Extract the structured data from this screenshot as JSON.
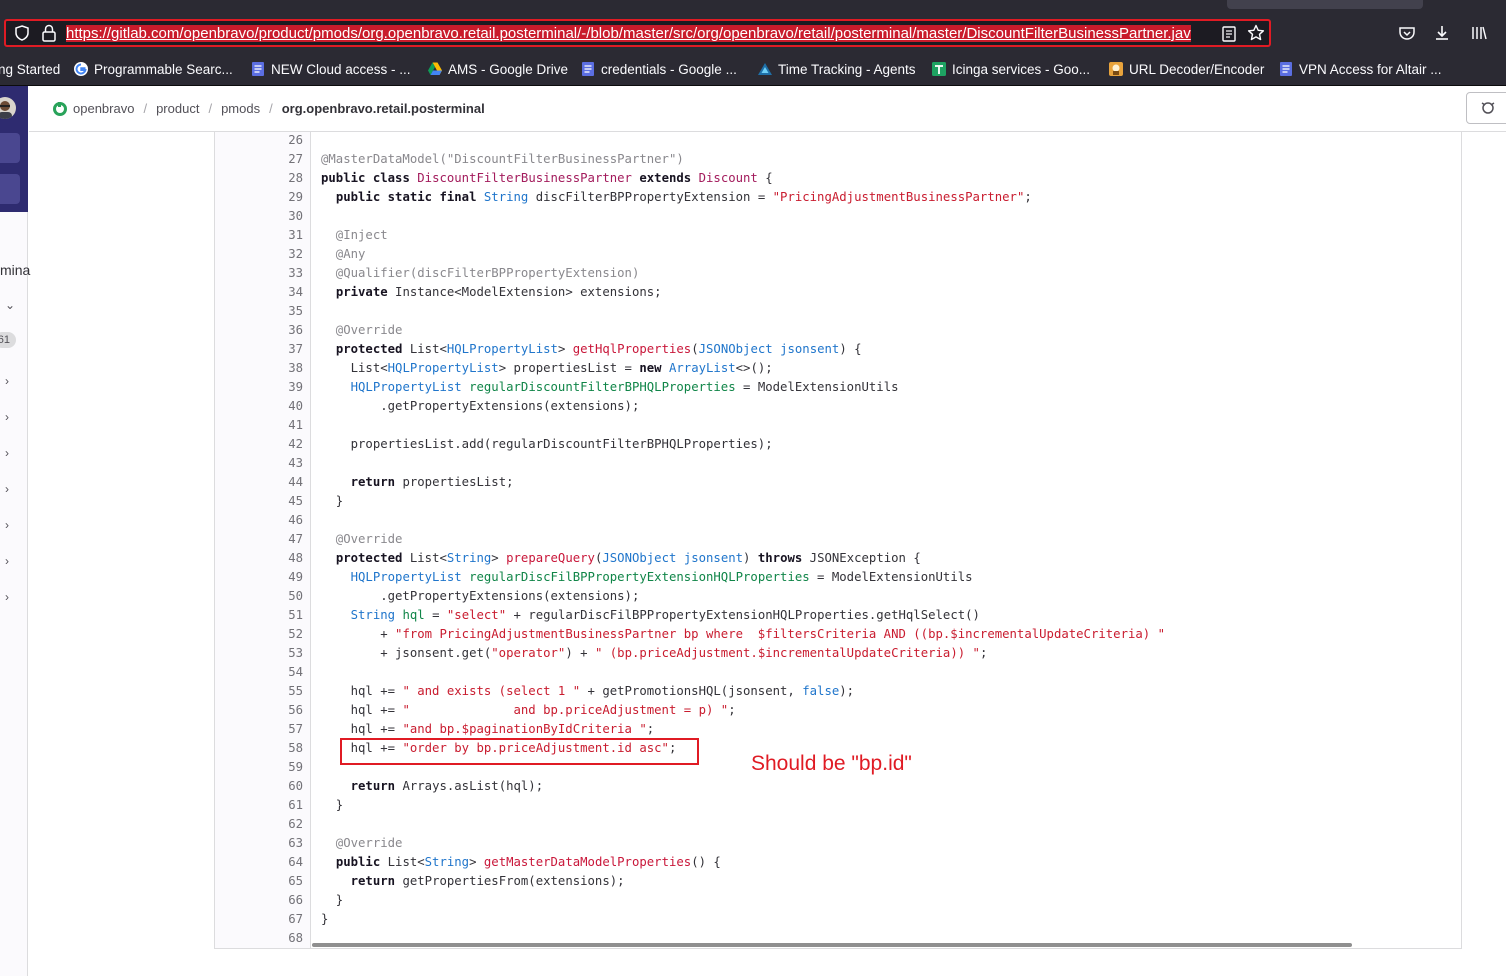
{
  "browser": {
    "url": "https://gitlab.com/openbravo/product/pmods/org.openbravo.retail.posterminal/-/blob/master/src/org/openbravo/retail/posterminal/master/DiscountFilterBusinessPartner.jav",
    "bookmarks": [
      {
        "label": "ng Started",
        "icon": "none"
      },
      {
        "label": "Programmable Searc...",
        "icon": "google-icon"
      },
      {
        "label": "NEW Cloud access - ...",
        "icon": "docs-icon"
      },
      {
        "label": "AMS - Google Drive",
        "icon": "drive-icon"
      },
      {
        "label": "credentials - Google ...",
        "icon": "docs-icon"
      },
      {
        "label": "Time Tracking - Agents",
        "icon": "tracking-icon"
      },
      {
        "label": "Icinga services - Goo...",
        "icon": "sheets-icon"
      },
      {
        "label": "URL Decoder/Encoder",
        "icon": "decoder-icon"
      },
      {
        "label": "VPN Access for Altair ...",
        "icon": "docs-icon"
      }
    ]
  },
  "sidebar": {
    "truncated_label": "mina",
    "count_badge": "61"
  },
  "breadcrumb": {
    "items": [
      "openbravo",
      "product",
      "pmods",
      "org.openbravo.retail.posterminal"
    ]
  },
  "code": {
    "lines": [
      {
        "n": "26",
        "t": ""
      },
      {
        "n": "27",
        "t": "@MasterDataModel(\"DiscountFilterBusinessPartner\")"
      },
      {
        "n": "28",
        "t": "public class DiscountFilterBusinessPartner extends Discount {"
      },
      {
        "n": "29",
        "t": "  public static final String discFilterBPPropertyExtension = \"PricingAdjustmentBusinessPartner\";"
      },
      {
        "n": "30",
        "t": ""
      },
      {
        "n": "31",
        "t": "  @Inject"
      },
      {
        "n": "32",
        "t": "  @Any"
      },
      {
        "n": "33",
        "t": "  @Qualifier(discFilterBPPropertyExtension)"
      },
      {
        "n": "34",
        "t": "  private Instance<ModelExtension> extensions;"
      },
      {
        "n": "35",
        "t": ""
      },
      {
        "n": "36",
        "t": "  @Override"
      },
      {
        "n": "37",
        "t": "  protected List<HQLPropertyList> getHqlProperties(JSONObject jsonsent) {"
      },
      {
        "n": "38",
        "t": "    List<HQLPropertyList> propertiesList = new ArrayList<>();"
      },
      {
        "n": "39",
        "t": "    HQLPropertyList regularDiscountFilterBPHQLProperties = ModelExtensionUtils"
      },
      {
        "n": "40",
        "t": "        .getPropertyExtensions(extensions);"
      },
      {
        "n": "41",
        "t": ""
      },
      {
        "n": "42",
        "t": "    propertiesList.add(regularDiscountFilterBPHQLProperties);"
      },
      {
        "n": "43",
        "t": ""
      },
      {
        "n": "44",
        "t": "    return propertiesList;"
      },
      {
        "n": "45",
        "t": "  }"
      },
      {
        "n": "46",
        "t": ""
      },
      {
        "n": "47",
        "t": "  @Override"
      },
      {
        "n": "48",
        "t": "  protected List<String> prepareQuery(JSONObject jsonsent) throws JSONException {"
      },
      {
        "n": "49",
        "t": "    HQLPropertyList regularDiscFilBPPropertyExtensionHQLProperties = ModelExtensionUtils"
      },
      {
        "n": "50",
        "t": "        .getPropertyExtensions(extensions);"
      },
      {
        "n": "51",
        "t": "    String hql = \"select\" + regularDiscFilBPPropertyExtensionHQLProperties.getHqlSelect()"
      },
      {
        "n": "52",
        "t": "        + \"from PricingAdjustmentBusinessPartner bp where  $filtersCriteria AND ((bp.$incrementalUpdateCriteria) \""
      },
      {
        "n": "53",
        "t": "        + jsonsent.get(\"operator\") + \" (bp.priceAdjustment.$incrementalUpdateCriteria)) \";"
      },
      {
        "n": "54",
        "t": ""
      },
      {
        "n": "55",
        "t": "    hql += \" and exists (select 1 \" + getPromotionsHQL(jsonsent, false);"
      },
      {
        "n": "56",
        "t": "    hql += \"              and bp.priceAdjustment = p) \";"
      },
      {
        "n": "57",
        "t": "    hql += \"and bp.$paginationByIdCriteria \";"
      },
      {
        "n": "58",
        "t": "    hql += \"order by bp.priceAdjustment.id asc\";"
      },
      {
        "n": "59",
        "t": ""
      },
      {
        "n": "60",
        "t": "    return Arrays.asList(hql);"
      },
      {
        "n": "61",
        "t": "  }"
      },
      {
        "n": "62",
        "t": ""
      },
      {
        "n": "63",
        "t": "  @Override"
      },
      {
        "n": "64",
        "t": "  public List<String> getMasterDataModelProperties() {"
      },
      {
        "n": "65",
        "t": "    return getPropertiesFrom(extensions);"
      },
      {
        "n": "66",
        "t": "  }"
      },
      {
        "n": "67",
        "t": "}"
      },
      {
        "n": "68",
        "t": ""
      }
    ]
  },
  "annotation": {
    "text": "Should be \"bp.id\""
  },
  "colors": {
    "annotation_red": "#e01b24",
    "browser_chrome": "#2b2a33",
    "gitlab_sidebar_dark": "#2e2b70"
  }
}
